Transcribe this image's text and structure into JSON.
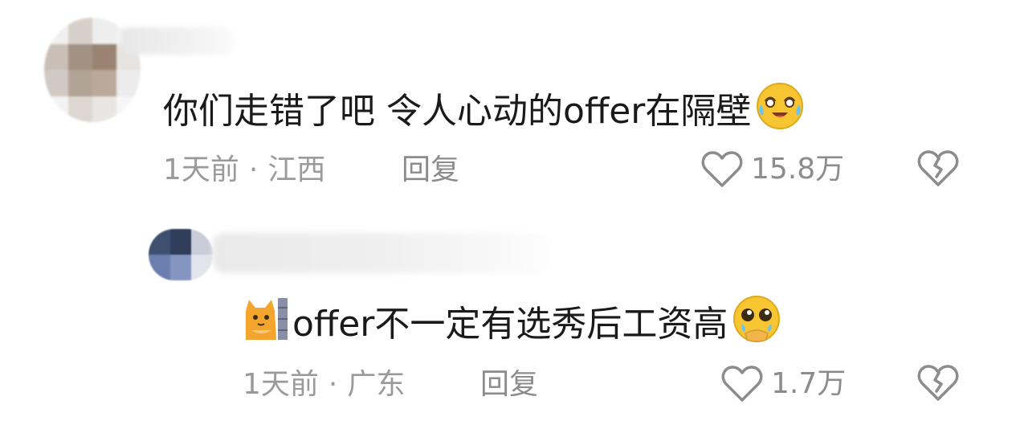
{
  "comments": [
    {
      "text": "你们走错了吧 令人心动的offer在隔壁",
      "emoji_icon": "crying-laughing-emoji-icon",
      "time": "1天前",
      "separator": "·",
      "location": "江西",
      "reply_label": "回复",
      "likes": "15.8万"
    },
    {
      "text": "offer不一定有选秀后工资高",
      "leading_icon": "cat-peeking-emoji-icon",
      "emoji_icon": "pleading-tearful-emoji-icon",
      "time": "1天前",
      "separator": "·",
      "location": "广东",
      "reply_label": "回复",
      "likes": "1.7万"
    }
  ],
  "colors": {
    "text": "#1a1a1a",
    "meta": "#9a9a9a",
    "icon": "#8c8c8c",
    "emoji_face": "#f7c531"
  }
}
